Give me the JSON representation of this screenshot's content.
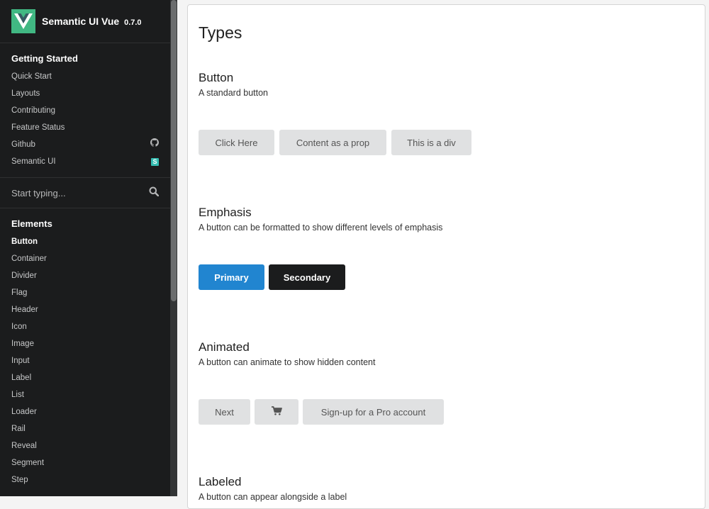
{
  "brand": {
    "title": "Semantic UI Vue",
    "version": "0.7.0"
  },
  "sidebar": {
    "getting_started": {
      "title": "Getting Started",
      "items": [
        {
          "label": "Quick Start"
        },
        {
          "label": "Layouts"
        },
        {
          "label": "Contributing"
        },
        {
          "label": "Feature Status"
        },
        {
          "label": "Github",
          "icon": "github-icon"
        },
        {
          "label": "Semantic UI",
          "icon": "semantic-ui-icon",
          "badge": "S"
        }
      ]
    },
    "search": {
      "placeholder": "Start typing..."
    },
    "elements": {
      "title": "Elements",
      "active": "Button",
      "items": [
        {
          "label": "Button"
        },
        {
          "label": "Container"
        },
        {
          "label": "Divider"
        },
        {
          "label": "Flag"
        },
        {
          "label": "Header"
        },
        {
          "label": "Icon"
        },
        {
          "label": "Image"
        },
        {
          "label": "Input"
        },
        {
          "label": "Label"
        },
        {
          "label": "List"
        },
        {
          "label": "Loader"
        },
        {
          "label": "Rail"
        },
        {
          "label": "Reveal"
        },
        {
          "label": "Segment"
        },
        {
          "label": "Step"
        }
      ]
    }
  },
  "main": {
    "title": "Types",
    "sections": [
      {
        "heading": "Button",
        "description": "A standard button",
        "buttons": [
          "Click Here",
          "Content as a prop",
          "This is a div"
        ]
      },
      {
        "heading": "Emphasis",
        "description": "A button can be formatted to show different levels of emphasis",
        "buttons": [
          "Primary",
          "Secondary"
        ]
      },
      {
        "heading": "Animated",
        "description": "A button can animate to show hidden content",
        "buttons": [
          "Next",
          "",
          "Sign-up for a Pro account"
        ],
        "icons": [
          "cart-icon"
        ]
      },
      {
        "heading": "Labeled",
        "description": "A button can appear alongside a label"
      }
    ]
  },
  "colors": {
    "primary": "#2185d0",
    "secondary": "#1b1c1d",
    "sidebar": "#1b1c1d",
    "logo": "#41b883",
    "badge": "#35bdb2"
  }
}
